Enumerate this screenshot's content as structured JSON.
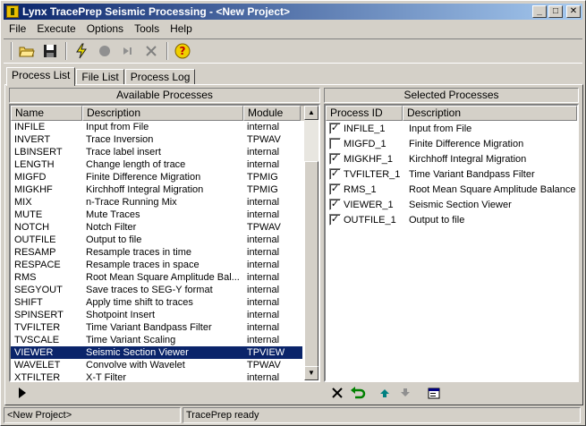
{
  "window": {
    "title": "Lynx TracePrep Seismic Processing - <New Project>",
    "minimize_glyph": "_",
    "maximize_glyph": "□",
    "close_glyph": "✕"
  },
  "menu": [
    "File",
    "Execute",
    "Options",
    "Tools",
    "Help"
  ],
  "toolbar_icons": [
    "open-folder-icon",
    "save-icon",
    "lightning-icon",
    "record-icon",
    "step-icon",
    "cancel-icon",
    "help-icon"
  ],
  "tabs": [
    "Process List",
    "File List",
    "Process Log"
  ],
  "available": {
    "header": "Available Processes",
    "columns": [
      "Name",
      "Description",
      "Module"
    ],
    "rows": [
      [
        "INFILE",
        "Input from File",
        "internal"
      ],
      [
        "INVERT",
        "Trace Inversion",
        "TPWAV"
      ],
      [
        "LBINSERT",
        "Trace label insert",
        "internal"
      ],
      [
        "LENGTH",
        "Change length of trace",
        "internal"
      ],
      [
        "MIGFD",
        "Finite Difference Migration",
        "TPMIG"
      ],
      [
        "MIGKHF",
        "Kirchhoff Integral Migration",
        "TPMIG"
      ],
      [
        "MIX",
        "n-Trace Running Mix",
        "internal"
      ],
      [
        "MUTE",
        "Mute Traces",
        "internal"
      ],
      [
        "NOTCH",
        "Notch Filter",
        "TPWAV"
      ],
      [
        "OUTFILE",
        "Output to file",
        "internal"
      ],
      [
        "RESAMP",
        "Resample traces in time",
        "internal"
      ],
      [
        "RESPACE",
        "Resample traces in space",
        "internal"
      ],
      [
        "RMS",
        "Root Mean Square Amplitude Bal...",
        "internal"
      ],
      [
        "SEGYOUT",
        "Save traces to SEG-Y format",
        "internal"
      ],
      [
        "SHIFT",
        "Apply time shift to traces",
        "internal"
      ],
      [
        "SPINSERT",
        "Shotpoint Insert",
        "internal"
      ],
      [
        "TVFILTER",
        "Time Variant Bandpass Filter",
        "internal"
      ],
      [
        "TVSCALE",
        "Time Variant Scaling",
        "internal"
      ],
      [
        "VIEWER",
        "Seismic Section Viewer",
        "TPVIEW"
      ],
      [
        "WAVELET",
        "Convolve with Wavelet",
        "TPWAV"
      ],
      [
        "XTFILTER",
        "X-T Filter",
        "internal"
      ]
    ],
    "selected_index": 18,
    "scroll_up": "▲",
    "scroll_down": "▼"
  },
  "selected": {
    "header": "Selected Processes",
    "columns": [
      "Process ID",
      "Description"
    ],
    "rows": [
      {
        "id": "INFILE_1",
        "desc": "Input from File",
        "checked": true
      },
      {
        "id": "MIGFD_1",
        "desc": "Finite Difference Migration",
        "checked": false
      },
      {
        "id": "MIGKHF_1",
        "desc": "Kirchhoff Integral Migration",
        "checked": true
      },
      {
        "id": "TVFILTER_1",
        "desc": "Time Variant Bandpass Filter",
        "checked": true
      },
      {
        "id": "RMS_1",
        "desc": "Root Mean Square Amplitude Balance",
        "checked": true
      },
      {
        "id": "VIEWER_1",
        "desc": "Seismic Section Viewer",
        "checked": true
      },
      {
        "id": "OUTFILE_1",
        "desc": "Output to file",
        "checked": true
      }
    ],
    "highlight_index": 6
  },
  "status": {
    "project": "<New Project>",
    "message": "TracePrep ready"
  }
}
